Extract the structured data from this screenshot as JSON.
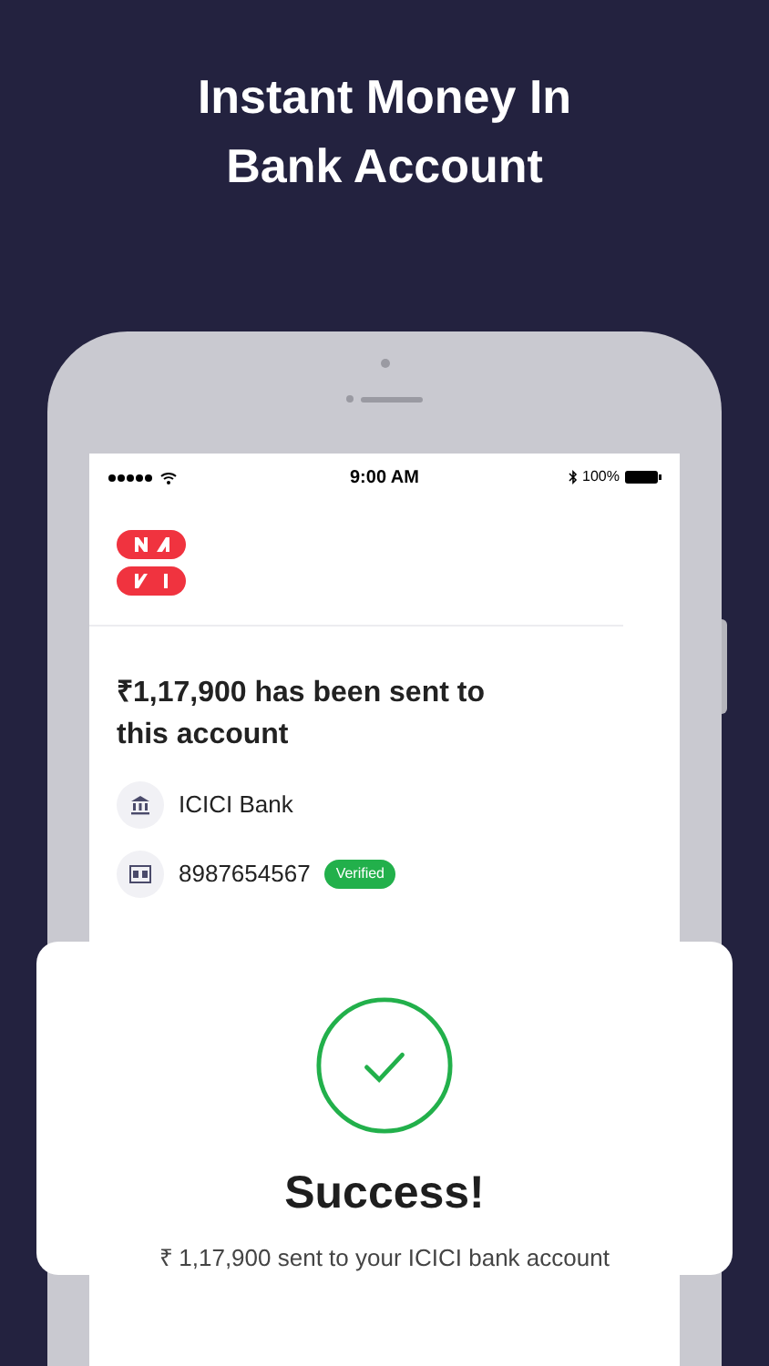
{
  "headline": [
    "Instant Money In",
    "Bank Account"
  ],
  "status_bar": {
    "time": "9:00 AM",
    "battery": "100%"
  },
  "transfer": {
    "title": "₹1,17,900 has been sent to this account",
    "rows": [
      {
        "kind": "bank",
        "text": "ICICI Bank"
      },
      {
        "kind": "account",
        "text": "8987654567",
        "badge": "Verified"
      }
    ]
  },
  "success": {
    "title": "Success!",
    "message": "₹ 1,17,900 sent to your ICICI bank account"
  }
}
